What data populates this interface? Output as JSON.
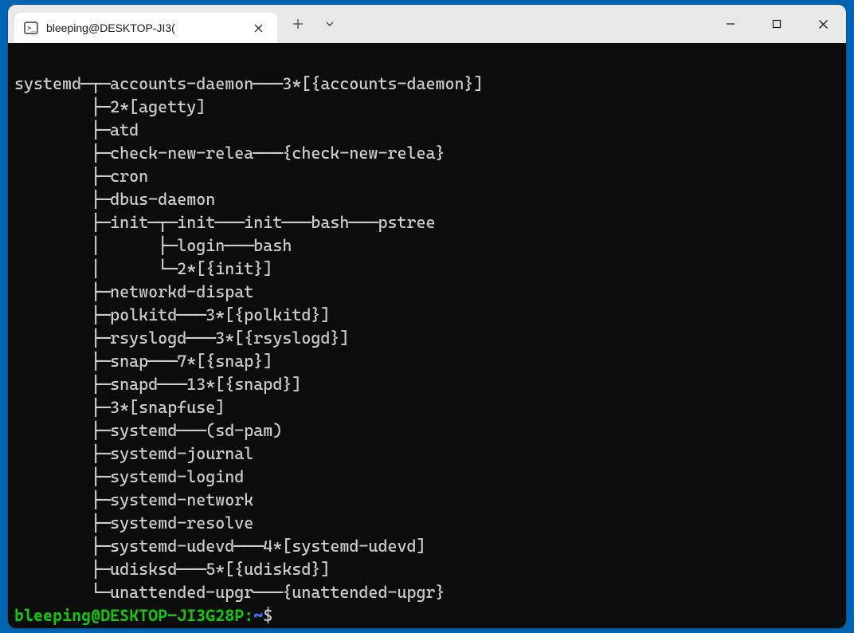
{
  "window": {
    "tab_title": "bleeping@DESKTOP-JI3(",
    "prompt_user_host": "bleeping@DESKTOP-JI3G28P",
    "prompt_separator": ":",
    "prompt_path": "~",
    "prompt_symbol": "$"
  },
  "pstree_output": {
    "root": "systemd",
    "lines": [
      "systemd─┬─accounts-daemon───3*[{accounts-daemon}]",
      "        ├─2*[agetty]",
      "        ├─atd",
      "        ├─check-new-relea───{check-new-relea}",
      "        ├─cron",
      "        ├─dbus-daemon",
      "        ├─init─┬─init───init───bash───pstree",
      "        │      ├─login───bash",
      "        │      └─2*[{init}]",
      "        ├─networkd-dispat",
      "        ├─polkitd───3*[{polkitd}]",
      "        ├─rsyslogd───3*[{rsyslogd}]",
      "        ├─snap───7*[{snap}]",
      "        ├─snapd───13*[{snapd}]",
      "        ├─3*[snapfuse]",
      "        ├─systemd───(sd-pam)",
      "        ├─systemd-journal",
      "        ├─systemd-logind",
      "        ├─systemd-network",
      "        ├─systemd-resolve",
      "        ├─systemd-udevd───4*[systemd-udevd]",
      "        ├─udisksd───5*[{udisksd}]",
      "        └─unattended-upgr───{unattended-upgr}"
    ]
  },
  "colors": {
    "window_bg": "#0c0c0c",
    "text": "#cccccc",
    "prompt_green": "#16c60c",
    "prompt_blue": "#3b78ff",
    "desktop_accent": "#0063B1"
  }
}
